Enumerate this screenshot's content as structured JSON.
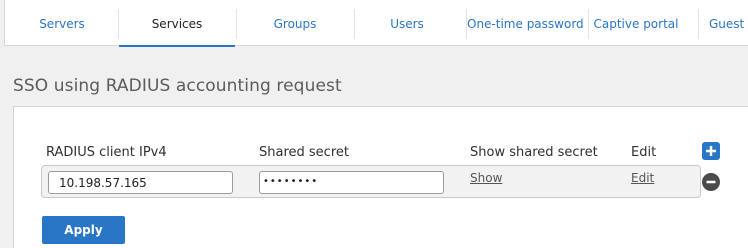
{
  "tabs": [
    {
      "label": "Servers",
      "active": false
    },
    {
      "label": "Services",
      "active": true
    },
    {
      "label": "Groups",
      "active": false
    },
    {
      "label": "Users",
      "active": false
    },
    {
      "label": "One-time password",
      "active": false
    },
    {
      "label": "Captive portal",
      "active": false
    },
    {
      "label": "Guest",
      "active": false
    }
  ],
  "section": {
    "title": "SSO using RADIUS accounting request"
  },
  "table": {
    "headers": {
      "client_ip": "RADIUS client IPv4",
      "shared_secret": "Shared secret",
      "show_secret": "Show shared secret",
      "edit": "Edit"
    },
    "rows": [
      {
        "client_ip": "10.198.57.165",
        "shared_secret": "••••••••",
        "show_link": "Show",
        "edit_link": "Edit"
      }
    ]
  },
  "actions": {
    "apply": "Apply"
  },
  "colors": {
    "accent": "#2a76c6",
    "remove": "#4a4a4a"
  },
  "icons": {
    "add": "plus-icon",
    "remove": "minus-circle-icon"
  }
}
